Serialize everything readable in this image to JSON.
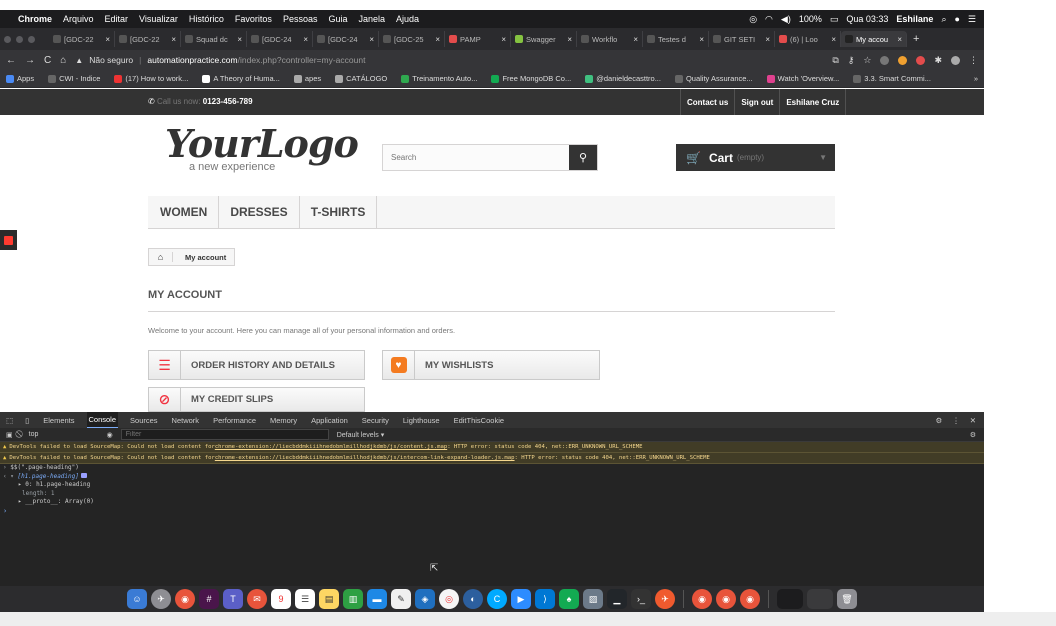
{
  "menubar": {
    "app": "Chrome",
    "items": [
      "Arquivo",
      "Editar",
      "Visualizar",
      "Histórico",
      "Favoritos",
      "Pessoas",
      "Guia",
      "Janela",
      "Ajuda"
    ],
    "battery": "100%",
    "clock": "Qua 03:33",
    "user": "Eshilane"
  },
  "tabs": [
    {
      "label": "[GDC-22",
      "color": "#555"
    },
    {
      "label": "[GDC-22",
      "color": "#555"
    },
    {
      "label": "Squad dc",
      "color": "#555"
    },
    {
      "label": "[GDC-24",
      "color": "#555"
    },
    {
      "label": "[GDC-24",
      "color": "#555"
    },
    {
      "label": "[GDC-25",
      "color": "#555"
    },
    {
      "label": "PAMP",
      "color": "#e34c4c"
    },
    {
      "label": "Swagger",
      "color": "#85c341"
    },
    {
      "label": "Workflo",
      "color": "#555"
    },
    {
      "label": "Testes d",
      "color": "#555"
    },
    {
      "label": "GIT SETI",
      "color": "#555"
    },
    {
      "label": "(6) | Loo",
      "color": "#e34c4c"
    },
    {
      "label": "My accou",
      "color": "#222"
    }
  ],
  "address": {
    "security": "Não seguro",
    "domain": "automationpractice.com",
    "path": "/index.php?controller=my-account"
  },
  "bookmarks": [
    "Apps",
    "CWI - Indice",
    "(17) How to work...",
    "A Theory of Huma...",
    "apes",
    "CATÁLOGO",
    "Treinamento Auto...",
    "Free MongoDB Co...",
    "@danieldecasttro...",
    "Quality Assurance...",
    "Watch 'Overview...",
    "3.3. Smart Commi...",
    "»"
  ],
  "site": {
    "call_label": "Call us now:",
    "phone": "0123-456-789",
    "top_links": [
      "Contact us",
      "Sign out",
      "Eshilane Cruz"
    ],
    "logo": "YourLogo",
    "logo_sub": "a new experience",
    "search_placeholder": "Search",
    "cart_label": "Cart",
    "cart_state": "(empty)",
    "menu": [
      "WOMEN",
      "DRESSES",
      "T-SHIRTS"
    ],
    "breadcrumb": "My account",
    "heading": "MY ACCOUNT",
    "intro": "Welcome to your account. Here you can manage all of your personal information and orders.",
    "buttons": {
      "orders": "ORDER HISTORY AND DETAILS",
      "wishlist": "MY WISHLISTS",
      "credit": "MY CREDIT SLIPS"
    }
  },
  "devtools": {
    "panels": [
      "Elements",
      "Console",
      "Sources",
      "Network",
      "Performance",
      "Memory",
      "Application",
      "Security",
      "Lighthouse",
      "EditThisCookie"
    ],
    "active": "Console",
    "context": "top",
    "filter_placeholder": "Filter",
    "levels": "Default levels ▾",
    "warnings": [
      {
        "pre": "DevTools failed to load SourceMap: Could not load content for ",
        "link": "chrome-extension://liecbddmkiiihnedobmlmillhodjkdmb/js/content.js.map",
        "post": ": HTTP error: status code 404, net::ERR_UNKNOWN_URL_SCHEME"
      },
      {
        "pre": "DevTools failed to load SourceMap: Could not load content for ",
        "link": "chrome-extension://liecbddmkiiihnedobmlmillhodjkdmb/js/intercom-link-expand-loader.js.map",
        "post": ": HTTP error: status code 404, net::ERR_UNKNOWN_URL_SCHEME"
      }
    ],
    "command": "$$(\".page-heading\")",
    "result": "[h1.page-heading]",
    "item0": "0: h1.page-heading",
    "length": "length: 1",
    "proto": "__proto__: Array(0)"
  }
}
